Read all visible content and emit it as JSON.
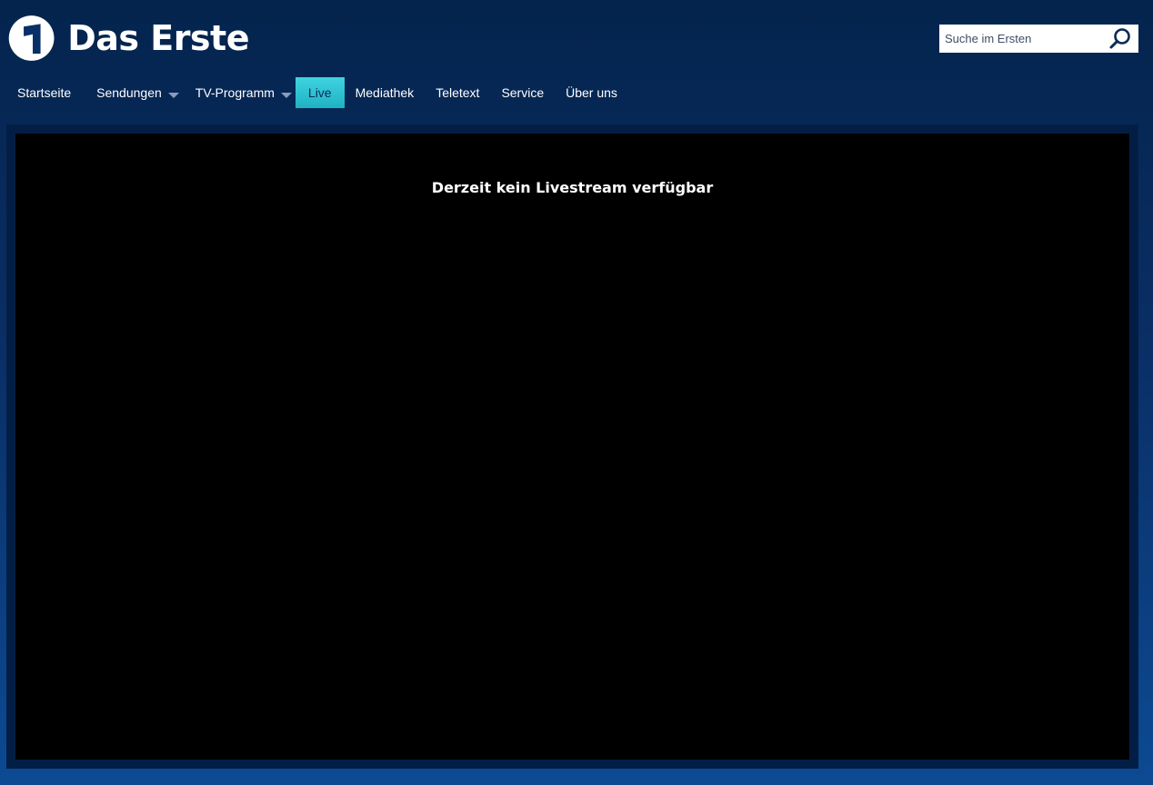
{
  "header": {
    "brand_name": "Das Erste",
    "logo_icon": "ard-one-icon"
  },
  "search": {
    "placeholder": "Suche im Ersten",
    "value": "",
    "icon": "search-icon"
  },
  "nav": {
    "items": [
      {
        "label": "Startseite"
      },
      {
        "label": "Sendungen",
        "dropdown": true
      },
      {
        "label": "TV-Programm",
        "dropdown": true
      },
      {
        "label": "Live",
        "active": true
      },
      {
        "label": "Mediathek"
      },
      {
        "label": "Teletext"
      },
      {
        "label": "Service"
      },
      {
        "label": "Über uns"
      }
    ]
  },
  "player": {
    "message": "Derzeit kein Livestream verfügbar"
  },
  "colors": {
    "background_top": "#04244d",
    "background_bottom": "#0c4a93",
    "active_tab": "#2cc3d1",
    "player_frame": "#031e45"
  }
}
